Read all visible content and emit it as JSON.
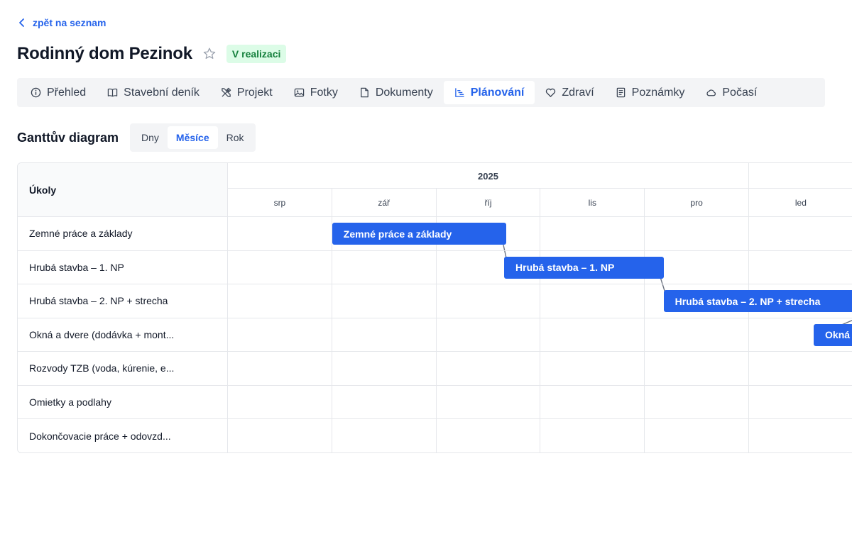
{
  "nav": {
    "back_label": "zpět na seznam"
  },
  "project": {
    "title": "Rodinný dom Pezinok",
    "status": "V realizaci",
    "status_color": "#15803d"
  },
  "tabs": [
    {
      "label": "Přehled",
      "icon": "info-icon",
      "active": false
    },
    {
      "label": "Stavební deník",
      "icon": "book-icon",
      "active": false
    },
    {
      "label": "Projekt",
      "icon": "tools-icon",
      "active": false
    },
    {
      "label": "Fotky",
      "icon": "image-icon",
      "active": false
    },
    {
      "label": "Dokumenty",
      "icon": "file-icon",
      "active": false
    },
    {
      "label": "Plánování",
      "icon": "chart-icon",
      "active": true
    },
    {
      "label": "Zdraví",
      "icon": "heart-icon",
      "active": false
    },
    {
      "label": "Poznámky",
      "icon": "notes-icon",
      "active": false
    },
    {
      "label": "Počasí",
      "icon": "cloud-icon",
      "active": false
    }
  ],
  "gantt": {
    "title": "Ganttův diagram",
    "view_options": [
      {
        "label": "Dny",
        "active": false
      },
      {
        "label": "Měsíce",
        "active": true
      },
      {
        "label": "Rok",
        "active": false
      }
    ],
    "tasks_header": "Úkoly",
    "year": "2025",
    "months": [
      "srp",
      "zář",
      "říj",
      "lis",
      "pro",
      "led"
    ],
    "tasks": [
      {
        "name": "Zemné práce a základy",
        "bar_label": "Zemné práce a základy",
        "start_month": 1.0,
        "end_month": 2.67
      },
      {
        "name": "Hrubá stavba – 1. NP",
        "bar_label": "Hrubá stavba – 1. NP",
        "start_month": 2.65,
        "end_month": 4.18
      },
      {
        "name": "Hrubá stavba – 2. NP + strecha",
        "bar_label": "Hrubá stavba – 2. NP + strecha",
        "start_month": 4.18,
        "end_month": 6.2
      },
      {
        "name": "Okná a dvere (dodávka + mont...",
        "bar_label": "Okná a dvere",
        "start_month": 5.62,
        "end_month": 6.5
      },
      {
        "name": "Rozvody TZB (voda, kúrenie, e...",
        "bar_label": "",
        "start_month": null,
        "end_month": null
      },
      {
        "name": "Omietky a podlahy",
        "bar_label": "",
        "start_month": null,
        "end_month": null
      },
      {
        "name": "Dokončovacie práce + odovzd...",
        "bar_label": "",
        "start_month": null,
        "end_month": null
      }
    ],
    "bar_color": "#2563eb",
    "link_color": "#6b7280"
  }
}
